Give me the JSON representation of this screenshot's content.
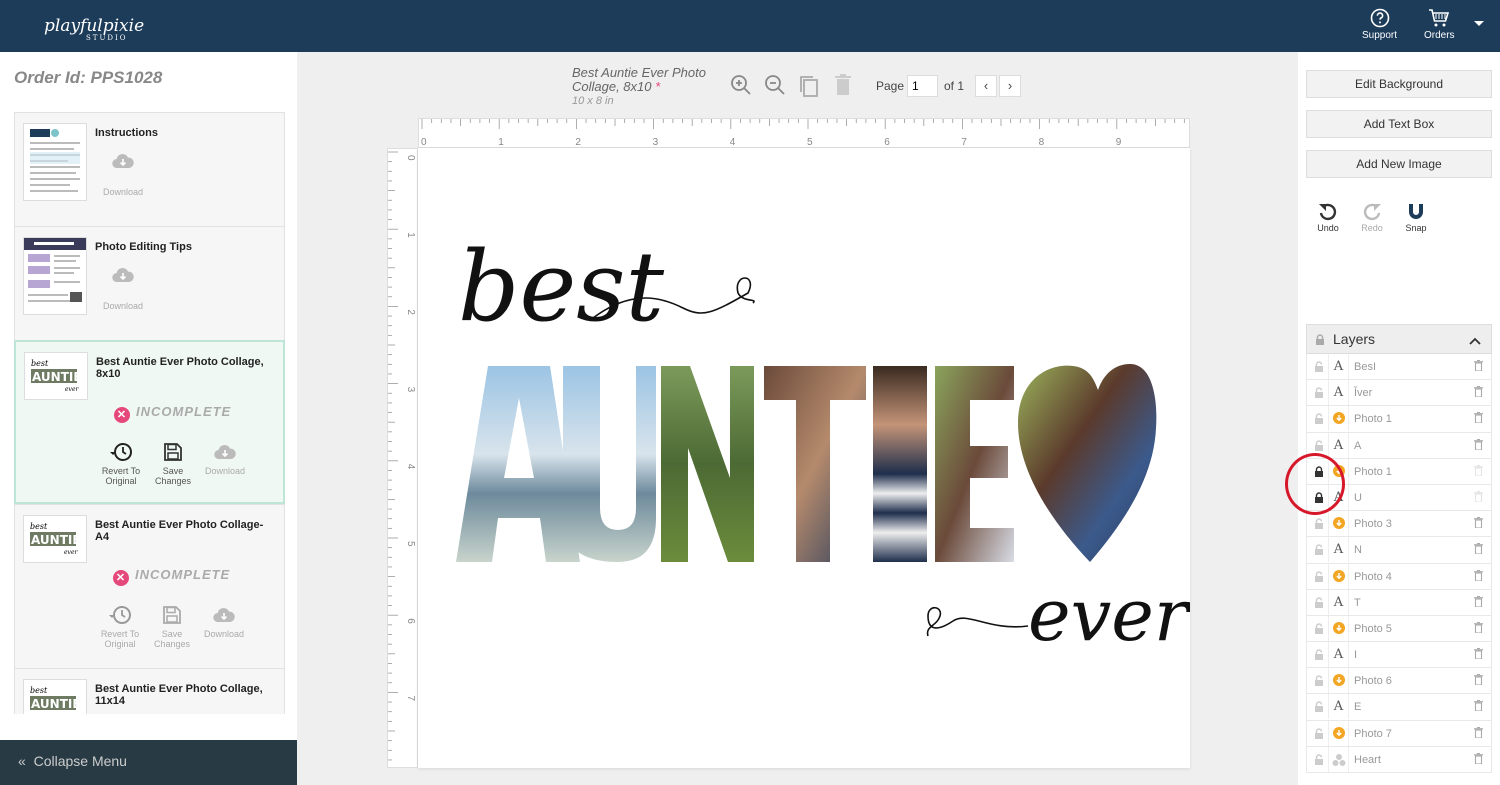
{
  "header": {
    "logo_text": "playfulpixie",
    "logo_sub": "STUDIO",
    "support_label": "Support",
    "orders_label": "Orders"
  },
  "left": {
    "order_id": "Order Id: PPS1028",
    "items": [
      {
        "title": "Instructions",
        "download": "Download"
      },
      {
        "title": "Photo Editing Tips",
        "download": "Download"
      },
      {
        "title": "Best Auntie Ever Photo Collage, 8x10",
        "status": "INCOMPLETE",
        "revert": "Revert To Original",
        "save": "Save Changes",
        "download": "Download"
      },
      {
        "title": "Best Auntie Ever Photo Collage- A4",
        "status": "INCOMPLETE",
        "revert": "Revert To Original",
        "save": "Save Changes",
        "download": "Download"
      },
      {
        "title": "Best Auntie Ever Photo Collage, 11x14"
      }
    ],
    "thumb_text": {
      "best": "best",
      "auntie": "AUNTIE",
      "ever": "ever"
    },
    "collapse_label": "Collapse Menu"
  },
  "editor": {
    "doc_title_1": "Best Auntie Ever Photo",
    "doc_title_2": "Collage, 8x10",
    "doc_star": "*",
    "doc_size": "10 x 8 in",
    "page_label": "Page",
    "page_value": "1",
    "page_of": "of 1",
    "prev": "‹",
    "next": "›",
    "ruler_h": [
      "0",
      "1",
      "2",
      "3",
      "4",
      "5",
      "6",
      "7",
      "8",
      "9"
    ],
    "ruler_v": [
      "0",
      "1",
      "2",
      "3",
      "4",
      "5",
      "6",
      "7"
    ],
    "design": {
      "best": "best",
      "auntie": "AUNTIE",
      "ever": "ever"
    }
  },
  "right": {
    "edit_background": "Edit Background",
    "add_text_box": "Add Text Box",
    "add_new_image": "Add New Image",
    "undo": "Undo",
    "redo": "Redo",
    "snap": "Snap",
    "layers_title": "Layers",
    "layers": [
      {
        "name": "BesI",
        "type": "text",
        "locked": false
      },
      {
        "name": "Ĭver",
        "type": "text",
        "locked": false
      },
      {
        "name": "Photo 1",
        "type": "photo",
        "locked": false
      },
      {
        "name": "A",
        "type": "text",
        "locked": false
      },
      {
        "name": "Photo 1",
        "type": "photo",
        "locked": true
      },
      {
        "name": "U",
        "type": "text",
        "locked": true
      },
      {
        "name": "Photo 3",
        "type": "photo",
        "locked": false
      },
      {
        "name": "N",
        "type": "text",
        "locked": false
      },
      {
        "name": "Photo 4",
        "type": "photo",
        "locked": false
      },
      {
        "name": "T",
        "type": "text",
        "locked": false
      },
      {
        "name": "Photo 5",
        "type": "photo",
        "locked": false
      },
      {
        "name": "I",
        "type": "text",
        "locked": false
      },
      {
        "name": "Photo 6",
        "type": "photo",
        "locked": false
      },
      {
        "name": "E",
        "type": "text",
        "locked": false
      },
      {
        "name": "Photo 7",
        "type": "photo",
        "locked": false
      },
      {
        "name": "Heart",
        "type": "shape",
        "locked": false
      }
    ]
  },
  "colors": {
    "topbar": "#1d3c5a",
    "incomplete": "#e5487a",
    "selected_border": "#bfe5d6",
    "photo_layer": "#f2a623",
    "highlight_circle": "#d6182a"
  }
}
